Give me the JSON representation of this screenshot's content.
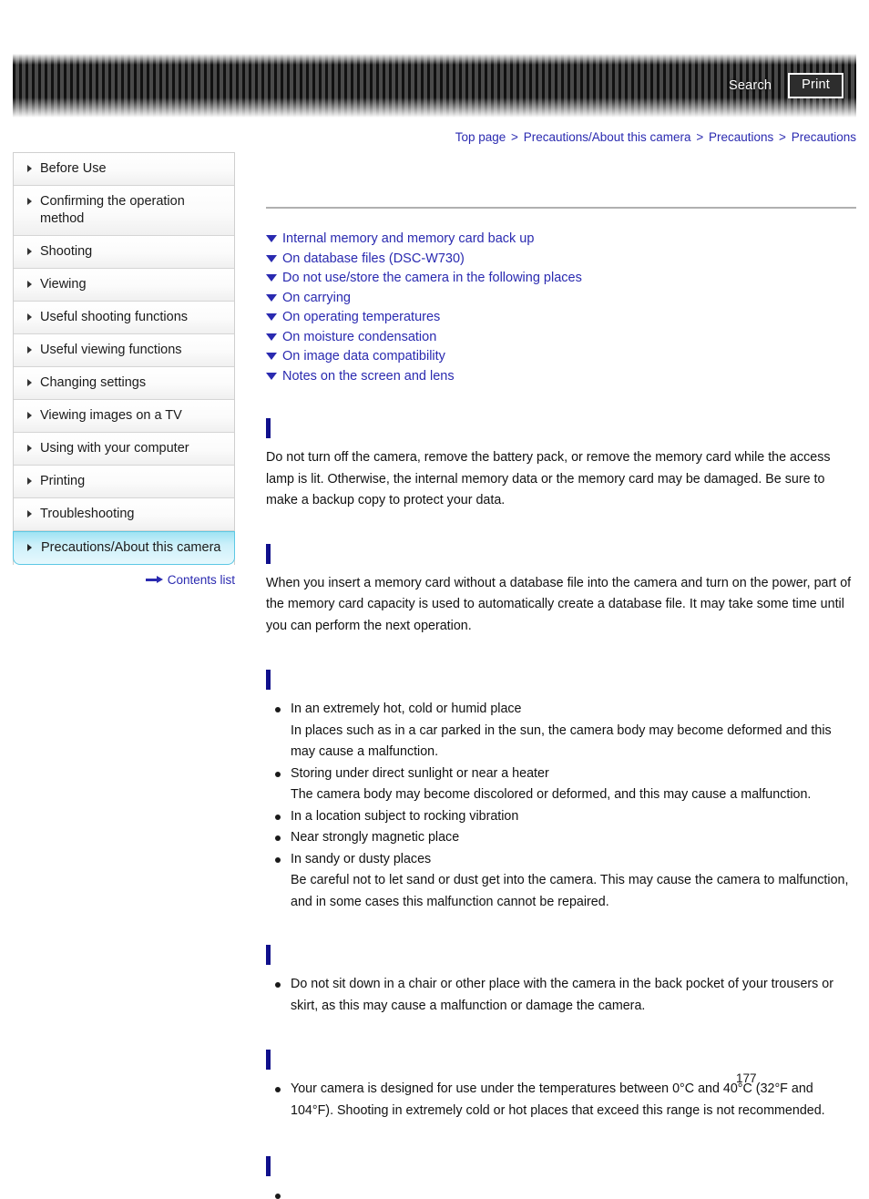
{
  "header": {
    "search_label": "Search",
    "print_label": "Print"
  },
  "breadcrumb": {
    "separator": ">",
    "items": [
      {
        "label": "Top page"
      },
      {
        "label": "Precautions/About this camera"
      },
      {
        "label": "Precautions"
      },
      {
        "label": "Precautions"
      }
    ]
  },
  "sidebar": {
    "items": [
      {
        "label": "Before Use",
        "selected": false
      },
      {
        "label": "Confirming the operation method",
        "selected": false
      },
      {
        "label": "Shooting",
        "selected": false
      },
      {
        "label": "Viewing",
        "selected": false
      },
      {
        "label": "Useful shooting functions",
        "selected": false
      },
      {
        "label": "Useful viewing functions",
        "selected": false
      },
      {
        "label": "Changing settings",
        "selected": false
      },
      {
        "label": "Viewing images on a TV",
        "selected": false
      },
      {
        "label": "Using with your computer",
        "selected": false
      },
      {
        "label": "Printing",
        "selected": false
      },
      {
        "label": "Troubleshooting",
        "selected": false
      },
      {
        "label": "Precautions/About this camera",
        "selected": true
      }
    ],
    "contents_list_label": "Contents list"
  },
  "main": {
    "page_title": "",
    "anchor_links": [
      {
        "label": "Internal memory and memory card back up"
      },
      {
        "label": "On database files (DSC-W730)"
      },
      {
        "label": "Do not use/store the camera in the following places"
      },
      {
        "label": "On carrying"
      },
      {
        "label": "On operating temperatures"
      },
      {
        "label": "On moisture condensation"
      },
      {
        "label": "On image data compatibility"
      },
      {
        "label": "Notes on the screen and lens"
      }
    ],
    "sections": [
      {
        "heading": "",
        "paragraph": "Do not turn off the camera, remove the battery pack, or remove the memory card while the access lamp is lit. Otherwise, the internal memory data or the memory card may be damaged. Be sure to make a backup copy to protect your data."
      },
      {
        "heading": "",
        "paragraph": "When you insert a memory card without a database file into the camera and turn on the power, part of the memory card capacity is used to automatically create a database file. It may take some time until you can perform the next operation."
      },
      {
        "heading": "",
        "bullets": [
          {
            "text": "In an extremely hot, cold or humid place",
            "detail": "In places such as in a car parked in the sun, the camera body may become deformed and this may cause a malfunction."
          },
          {
            "text": "Storing under direct sunlight or near a heater",
            "detail": "The camera body may become discolored or deformed, and this may cause a malfunction."
          },
          {
            "text": "In a location subject to rocking vibration",
            "detail": ""
          },
          {
            "text": "Near strongly magnetic place",
            "detail": ""
          },
          {
            "text": "In sandy or dusty places",
            "detail": "Be careful not to let sand or dust get into the camera. This may cause the camera to malfunction, and in some cases this malfunction cannot be repaired."
          }
        ]
      },
      {
        "heading": "",
        "bullets": [
          {
            "text": "Do not sit down in a chair or other place with the camera in the back pocket of your trousers or skirt, as this may cause a malfunction or damage the camera.",
            "detail": ""
          }
        ]
      },
      {
        "heading": "",
        "bullets": [
          {
            "text": "Your camera is designed for use under the temperatures between 0°C and 40°C (32°F and 104°F). Shooting in extremely cold or hot places that exceed this range is not recommended.",
            "detail": ""
          }
        ]
      },
      {
        "heading": "",
        "bullets": [
          {
            "text": "",
            "detail": ""
          }
        ]
      }
    ],
    "page_number": "177"
  }
}
